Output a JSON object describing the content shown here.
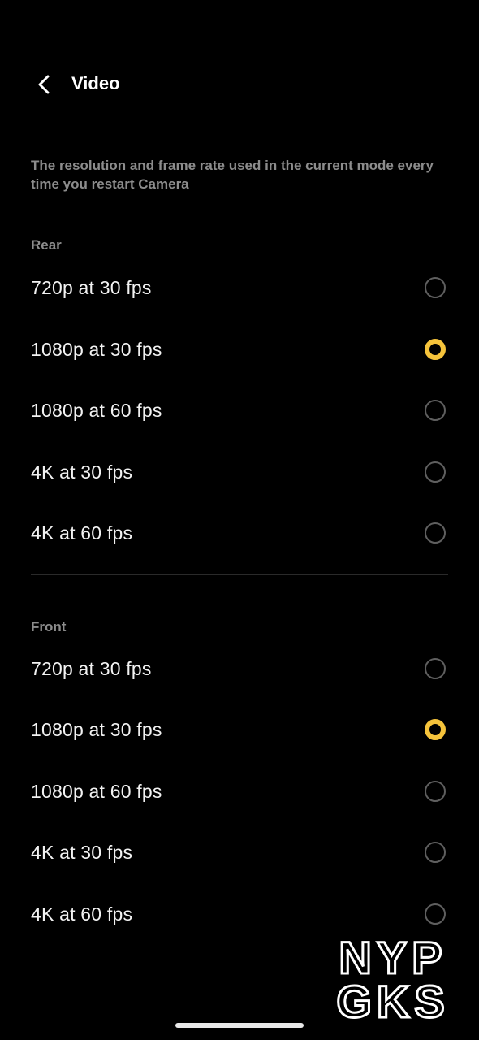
{
  "header": {
    "title": "Video"
  },
  "description": "The resolution and frame rate used in the current mode every time you restart Camera",
  "sections": [
    {
      "label": "Rear",
      "options": [
        {
          "label": "720p at 30 fps",
          "selected": false
        },
        {
          "label": "1080p at 30 fps",
          "selected": true
        },
        {
          "label": "1080p at 60 fps",
          "selected": false
        },
        {
          "label": "4K at 30 fps",
          "selected": false
        },
        {
          "label": "4K at 60 fps",
          "selected": false
        }
      ]
    },
    {
      "label": "Front",
      "options": [
        {
          "label": "720p at 30 fps",
          "selected": false
        },
        {
          "label": "1080p at 30 fps",
          "selected": true
        },
        {
          "label": "1080p at 60 fps",
          "selected": false
        },
        {
          "label": "4K at 30 fps",
          "selected": false
        },
        {
          "label": "4K at 60 fps",
          "selected": false
        }
      ]
    }
  ],
  "watermark": {
    "line1": "NYP",
    "line2": "GKS"
  },
  "colors": {
    "background": "#000000",
    "accent": "#f5c33b",
    "secondary_text": "#8c8c8c",
    "primary_text": "#f2f2f2",
    "radio_unselected": "#5f5f5f"
  }
}
